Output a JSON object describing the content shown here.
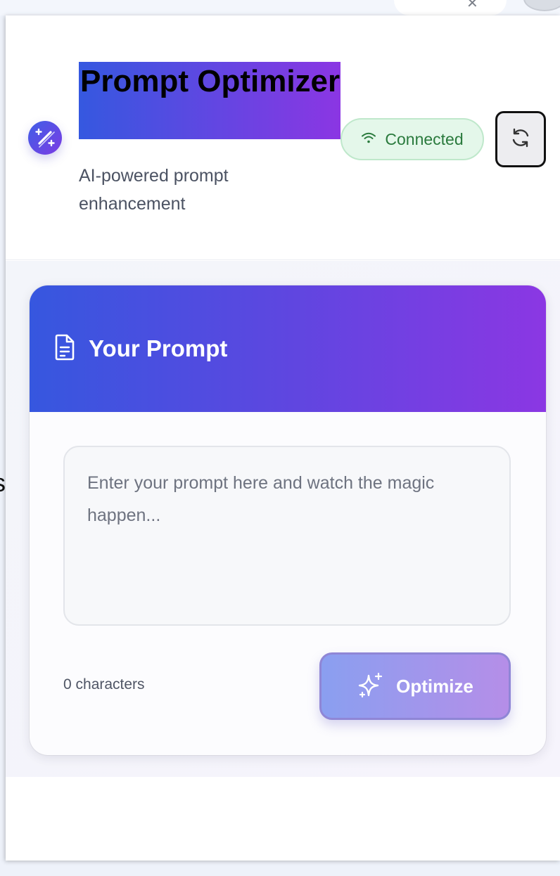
{
  "header": {
    "title": "Prompt Optimizer",
    "subtitle": "AI-powered prompt enhancement",
    "status": "Connected"
  },
  "prompt_card": {
    "title": "Your Prompt",
    "input_value": "",
    "input_placeholder": "Enter your prompt here and watch the magic happen...",
    "char_count": "0 characters",
    "optimize_label": "Optimize"
  },
  "background": {
    "edge_letter": "s"
  },
  "icons": {
    "logo": "magic-wand-icon",
    "status": "wifi-icon",
    "refresh": "refresh-icon",
    "card": "document-icon",
    "optimize": "sparkles-icon"
  },
  "colors": {
    "gradient_start": "#3657df",
    "gradient_end": "#8b37e3",
    "status_bg": "#e4f7ea",
    "status_text": "#2a7a3d"
  }
}
